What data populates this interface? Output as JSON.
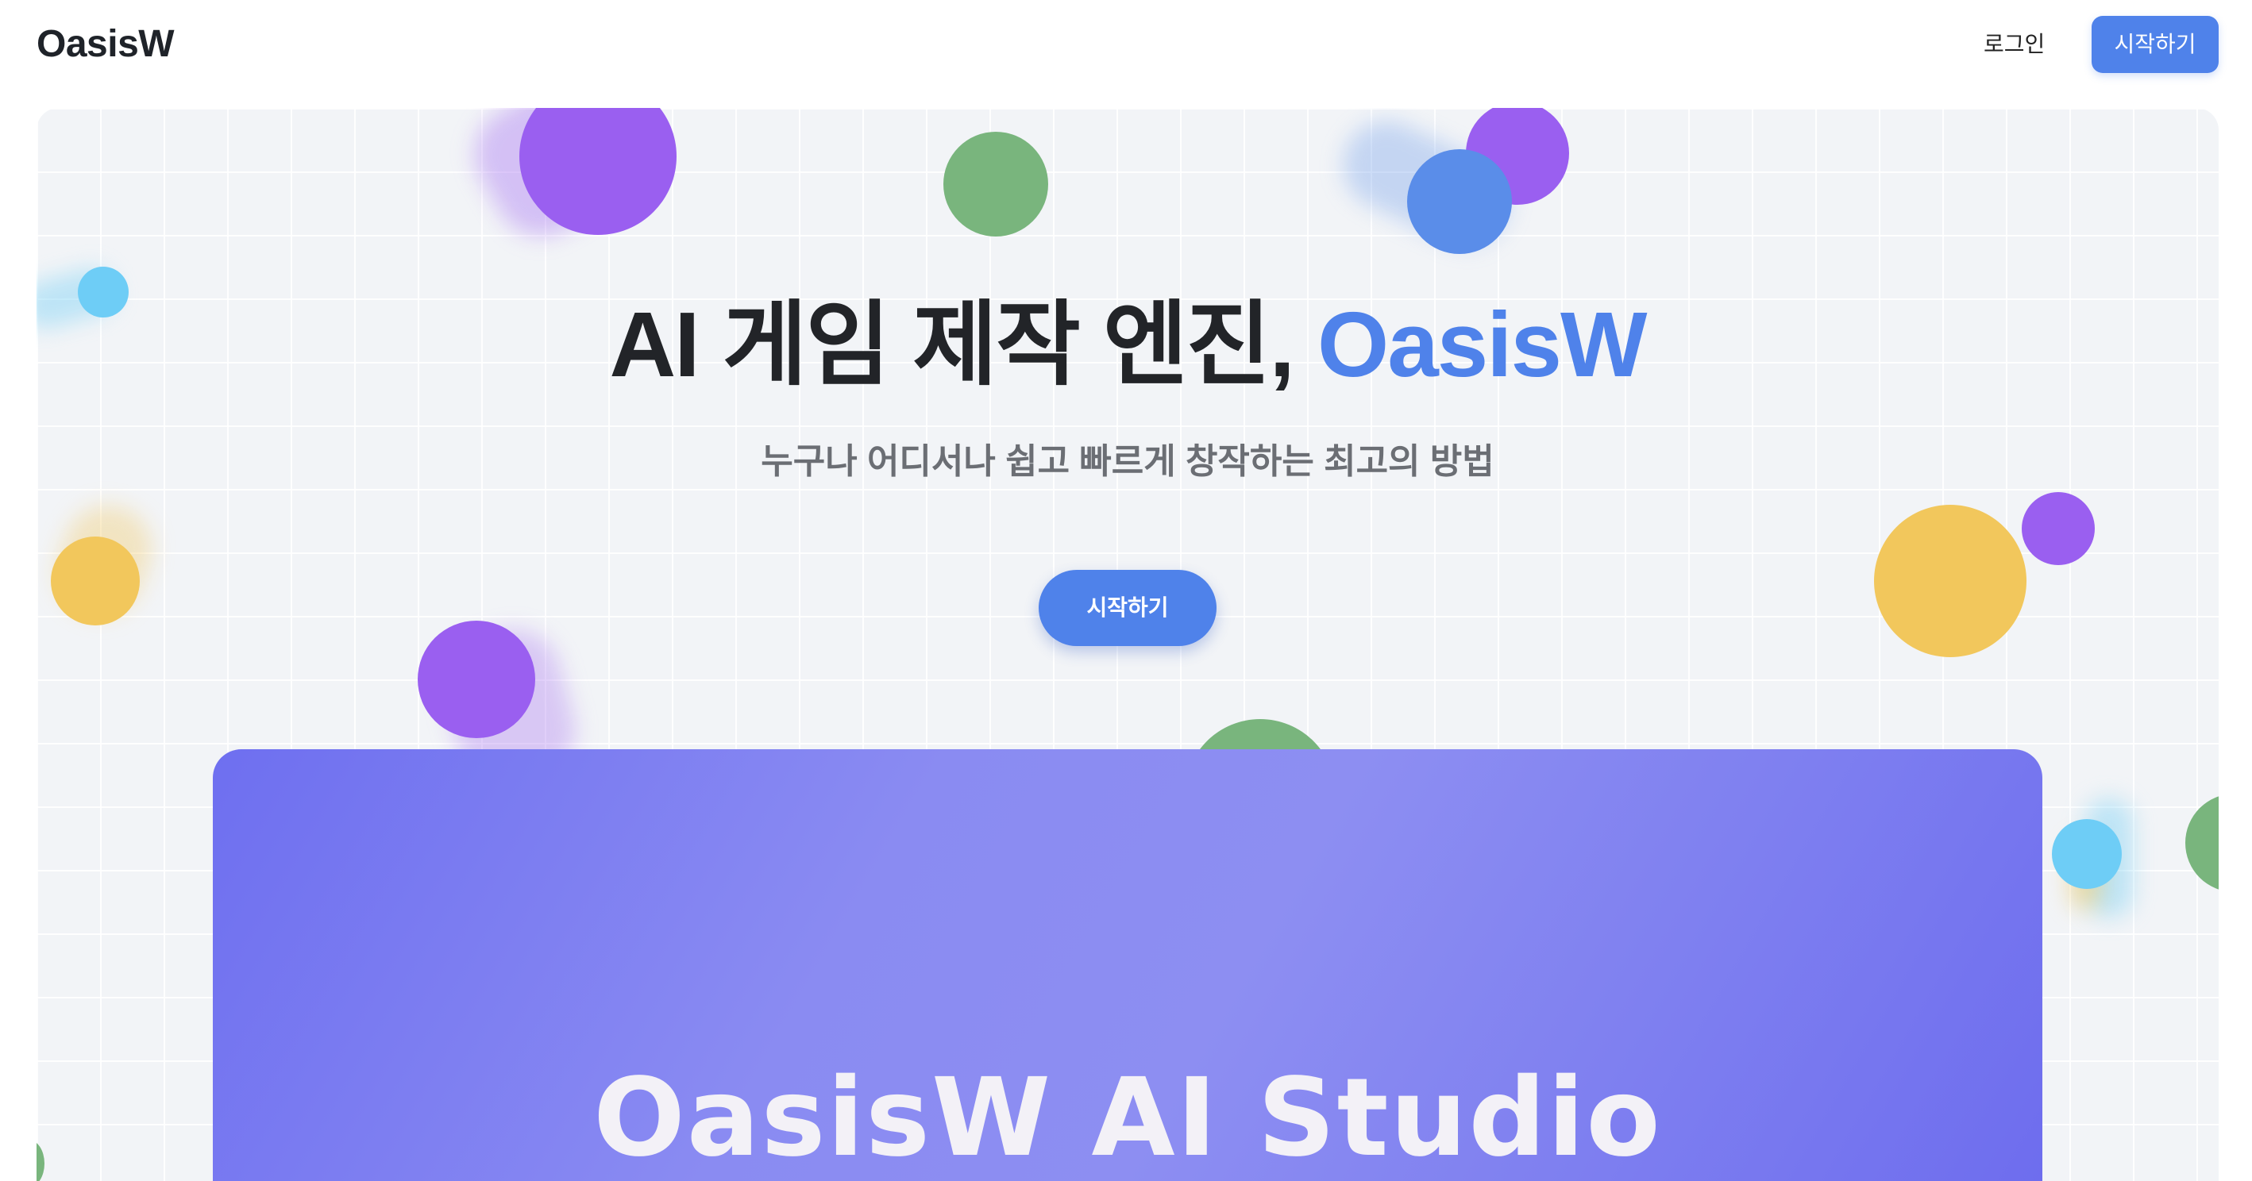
{
  "header": {
    "logo": "OasisW",
    "login_label": "로그인",
    "start_label": "시작하기"
  },
  "hero": {
    "headline_main": "AI 게임 제작 엔진, ",
    "headline_accent": "OasisW",
    "subtitle": "누구나 어디서나 쉽고 빠르게 창작하는 최고의 방법",
    "cta_label": "시작하기",
    "preview_title": "OasisW AI Studio"
  },
  "colors": {
    "accent": "#4f82ea",
    "hero_background": "#f2f4f7",
    "preview_gradient_start": "#6e6ff0",
    "preview_gradient_end": "#8d8ef2",
    "bubble_purple": "#9a5ff0",
    "bubble_green": "#79b57d",
    "bubble_blue": "#5a8de9",
    "bubble_cyan": "#6ecdf6",
    "bubble_yellow": "#f2c75c"
  }
}
